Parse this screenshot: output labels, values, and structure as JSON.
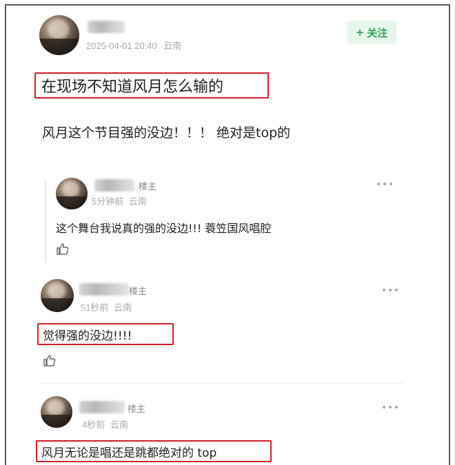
{
  "post": {
    "timestamp": "2025-04-01 20:40",
    "location": "云南",
    "follow_label": "关注",
    "follow_plus": "+",
    "title": "在现场不知道风月怎么输的",
    "content": "风月这个节目强的没边！！！ 绝对是top的"
  },
  "quoted_comment": {
    "badge": "楼主",
    "time": "5分钟前",
    "location": "云南",
    "text": "这个舞台我说真的强的没边!!! 蓑笠国风唱腔"
  },
  "comments": [
    {
      "badge": "楼主",
      "time": "51秒前",
      "location": "云南",
      "text": "觉得强的没边!!!!"
    },
    {
      "badge": "楼主",
      "time": "4秒前",
      "location": "云南",
      "text": "风月无论是唱还是跳都绝对的 top"
    }
  ],
  "icons": {
    "more": "more-dots-icon",
    "like": "thumbs-up-icon"
  },
  "colors": {
    "highlight_border": "#d21f2a",
    "follow_text": "#2f9f5b",
    "follow_bg": "#e7f6eb",
    "meta_text": "#a8a8a8"
  }
}
